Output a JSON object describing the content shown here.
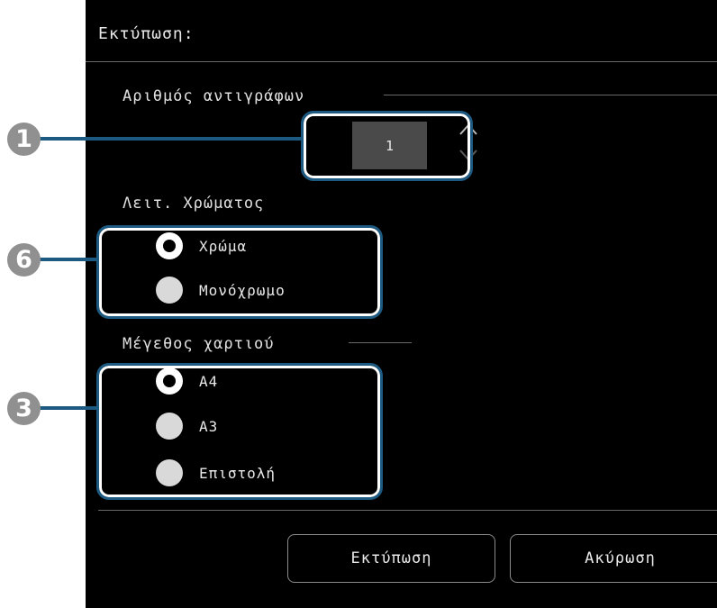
{
  "dialog": {
    "title": "Εκτύπωση:",
    "copies": {
      "label": "Αριθμός αντιγράφων",
      "value": "1"
    },
    "color_mode": {
      "label": "Λειτ. Χρώματος",
      "options": [
        {
          "label": "Χρώμα",
          "selected": true
        },
        {
          "label": "Μονόχρωμο",
          "selected": false
        }
      ]
    },
    "paper_size": {
      "label": "Μέγεθος χαρτιού",
      "options": [
        {
          "label": "A4",
          "selected": true
        },
        {
          "label": "A3",
          "selected": false
        },
        {
          "label": "Επιστολή",
          "selected": false
        }
      ]
    },
    "buttons": {
      "print": "Εκτύπωση",
      "cancel": "Ακύρωση"
    }
  },
  "callouts": {
    "copies": "1",
    "color_mode": "6",
    "paper_size": "3"
  },
  "colors": {
    "callout": "#1d5a82",
    "background": "#000000"
  }
}
